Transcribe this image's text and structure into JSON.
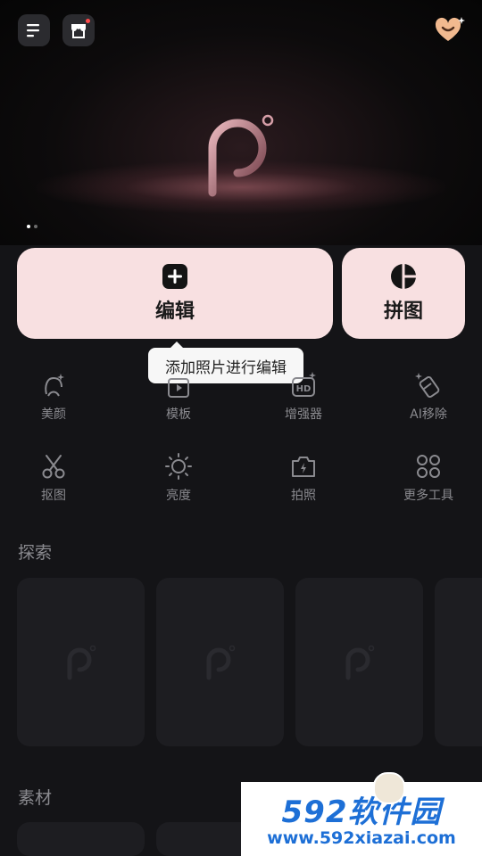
{
  "hero": {
    "active_slide": 1,
    "slide_count": 2
  },
  "header": {
    "menu_icon": "menu-icon",
    "store_icon": "store-icon",
    "vip_icon": "vip-heart-icon"
  },
  "actions": {
    "edit": {
      "label": "编辑",
      "icon": "plus-square-icon"
    },
    "collage": {
      "label": "拼图",
      "icon": "collage-icon"
    },
    "tooltip": "添加照片进行编辑"
  },
  "tools": [
    {
      "label": "美颜",
      "icon": "beauty-face-icon"
    },
    {
      "label": "模板",
      "icon": "template-icon"
    },
    {
      "label": "增强器",
      "icon": "hd-enhance-icon"
    },
    {
      "label": "AI移除",
      "icon": "eraser-icon"
    },
    {
      "label": "抠图",
      "icon": "scissors-icon"
    },
    {
      "label": "亮度",
      "icon": "brightness-icon"
    },
    {
      "label": "拍照",
      "icon": "camera-icon"
    },
    {
      "label": "更多工具",
      "icon": "more-tools-icon"
    }
  ],
  "explore": {
    "title": "探索"
  },
  "materials": {
    "title": "素材"
  },
  "watermark": {
    "brand": "592软件园",
    "url": "www.592xiazai.com"
  },
  "colors": {
    "background": "#141417",
    "accent_pink": "#f8e0e1",
    "watermark_blue": "#1d6fd6"
  }
}
